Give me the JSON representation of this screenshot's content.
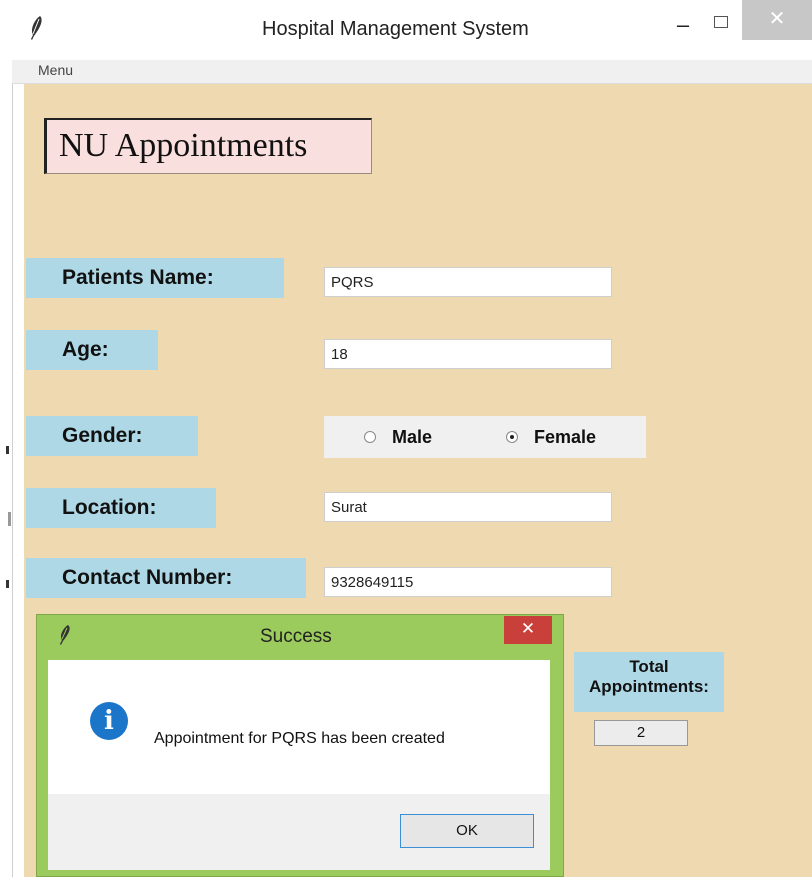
{
  "window": {
    "title": "Hospital Management System",
    "minimize_glyph": "–",
    "close_glyph": "✕"
  },
  "menubar": {
    "menu_label": "Menu"
  },
  "heading": {
    "text": "NU Appointments"
  },
  "form": {
    "name_label": "Patients Name:",
    "name_value": "PQRS",
    "age_label": "Age:",
    "age_value": "18",
    "gender_label": "Gender:",
    "gender_options": [
      "Male",
      "Female"
    ],
    "gender_selected": "Female",
    "location_label": "Location:",
    "location_value": "Surat",
    "contact_label": "Contact Number:",
    "contact_value": "9328649115"
  },
  "summary": {
    "total_label": "Total Appointments:",
    "total_value": "2"
  },
  "dialog": {
    "title": "Success",
    "message": "Appointment for PQRS has been created",
    "ok_label": "OK",
    "close_glyph": "✕",
    "info_glyph": "i"
  },
  "colors": {
    "content_bg": "#efd9b0",
    "label_bg": "#aed8e6",
    "heading_bg": "#f9dfdd",
    "dialog_frame": "#9bca5d",
    "dialog_close": "#c9403a",
    "info_icon": "#1b76c9"
  }
}
